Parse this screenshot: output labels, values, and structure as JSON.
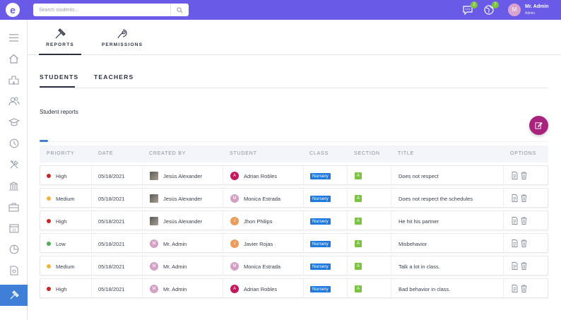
{
  "app": {
    "logo_letter": "e"
  },
  "search": {
    "placeholder": "Search students..."
  },
  "topbar": {
    "messages_count": "2",
    "notifications_count": "7",
    "user": {
      "initial": "M",
      "name": "Mr. Admin",
      "role": "Admin"
    }
  },
  "sidebar": {
    "items": [
      {
        "icon": "hamburger-icon"
      },
      {
        "icon": "home-icon"
      },
      {
        "icon": "school-icon"
      },
      {
        "icon": "users-icon"
      },
      {
        "icon": "graduation-cap-icon"
      },
      {
        "icon": "clock-icon"
      },
      {
        "icon": "tools-icon"
      },
      {
        "icon": "building-icon"
      },
      {
        "icon": "briefcase-icon"
      },
      {
        "icon": "calendar-icon",
        "label": "31"
      },
      {
        "icon": "pie-chart-icon"
      },
      {
        "icon": "settings-document-icon"
      },
      {
        "icon": "gavel-icon",
        "active": true
      }
    ]
  },
  "module_tabs": [
    {
      "label": "REPORTS",
      "icon": "gavel-icon",
      "active": true
    },
    {
      "label": "PERMISSIONS",
      "icon": "certificate-icon",
      "active": false
    }
  ],
  "page_tabs": [
    {
      "label": "STUDENTS",
      "active": true
    },
    {
      "label": "TEACHERS",
      "active": false
    }
  ],
  "section_title": "Student reports",
  "colors": {
    "accent": "#6a5ae8",
    "fab": "#a8237c",
    "high": "#c62828",
    "medium": "#f2b33d",
    "low": "#4caf50",
    "class_badge": "#1f7ae0",
    "section_badge": "#7cc242"
  },
  "table": {
    "headers": [
      "PRIORITY",
      "DATE",
      "CREATED BY",
      "STUDENT",
      "CLASS",
      "SECTION",
      "TITLE",
      "OPTIONS"
    ],
    "rows": [
      {
        "priority": "High",
        "priority_level": "high",
        "date": "05/18/2021",
        "created_by": "Jesús Alexander",
        "creator_type": "photo",
        "creator_initial": "",
        "student": "Adrian Robles",
        "student_initial": "A",
        "student_color": "#c2185b",
        "class": "Nursery",
        "section": "A",
        "title": "Does not respect"
      },
      {
        "priority": "Medium",
        "priority_level": "medium",
        "date": "05/18/2021",
        "created_by": "Jesús Alexander",
        "creator_type": "photo",
        "creator_initial": "",
        "student": "Monica Estrada",
        "student_initial": "M",
        "student_color": "#d4a0c4",
        "class": "Nursery",
        "section": "A",
        "title": "Does not respect the schedules"
      },
      {
        "priority": "High",
        "priority_level": "high",
        "date": "05/18/2021",
        "created_by": "Jesús Alexander",
        "creator_type": "photo",
        "creator_initial": "",
        "student": "Jhon Philips",
        "student_initial": "J",
        "student_color": "#ee9a5a",
        "class": "Nursery",
        "section": "A",
        "title": "He hit his partner"
      },
      {
        "priority": "Low",
        "priority_level": "low",
        "date": "05/18/2021",
        "created_by": "Mr. Admin",
        "creator_type": "initial",
        "creator_initial": "M",
        "student": "Javier Rojas",
        "student_initial": "J",
        "student_color": "#ee9a5a",
        "class": "Nursery",
        "section": "A",
        "title": "Misbehavior"
      },
      {
        "priority": "Medium",
        "priority_level": "medium",
        "date": "05/18/2021",
        "created_by": "Mr. Admin",
        "creator_type": "initial",
        "creator_initial": "M",
        "student": "Monica Estrada",
        "student_initial": "M",
        "student_color": "#d4a0c4",
        "class": "Nursery",
        "section": "A",
        "title": "Talk a lot in class."
      },
      {
        "priority": "High",
        "priority_level": "high",
        "date": "05/18/2021",
        "created_by": "Mr. Admin",
        "creator_type": "initial",
        "creator_initial": "M",
        "student": "Adrian Robles",
        "student_initial": "A",
        "student_color": "#c2185b",
        "class": "Nursery",
        "section": "A",
        "title": "Bad behavior in class."
      }
    ]
  }
}
